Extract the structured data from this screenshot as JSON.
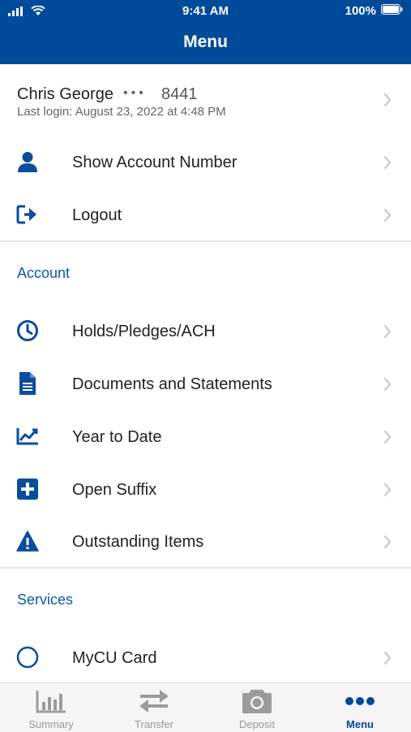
{
  "status_bar": {
    "time": "9:41 AM",
    "battery": "100%"
  },
  "header": {
    "title": "Menu"
  },
  "profile": {
    "name": "Chris George",
    "masked_dots": "•••",
    "account_suffix": "8441",
    "last_login": "Last login: August 23, 2022 at 4:48 PM"
  },
  "top_items": [
    {
      "label": "Show Account Number",
      "icon": "person-icon"
    },
    {
      "label": "Logout",
      "icon": "logout-icon"
    }
  ],
  "sections": {
    "account": {
      "title": "Account",
      "items": [
        {
          "label": "Holds/Pledges/ACH",
          "icon": "clock-icon"
        },
        {
          "label": "Documents and Statements",
          "icon": "document-icon"
        },
        {
          "label": "Year to Date",
          "icon": "line-chart-icon"
        },
        {
          "label": "Open Suffix",
          "icon": "plus-square-icon"
        },
        {
          "label": "Outstanding Items",
          "icon": "warning-icon"
        }
      ]
    },
    "services": {
      "title": "Services",
      "items": [
        {
          "label": "MyCU Card",
          "icon": "circle-icon"
        }
      ]
    }
  },
  "tabbar": {
    "tabs": [
      {
        "label": "Summary",
        "icon": "bar-chart-icon",
        "active": false
      },
      {
        "label": "Transfer",
        "icon": "transfer-arrows-icon",
        "active": false
      },
      {
        "label": "Deposit",
        "icon": "camera-icon",
        "active": false
      },
      {
        "label": "Menu",
        "icon": "more-dots-icon",
        "active": true
      }
    ]
  },
  "colors": {
    "brand": "#004a9a",
    "accent_text": "#0b5aa8",
    "inactive_tab": "#9b9b9b"
  }
}
